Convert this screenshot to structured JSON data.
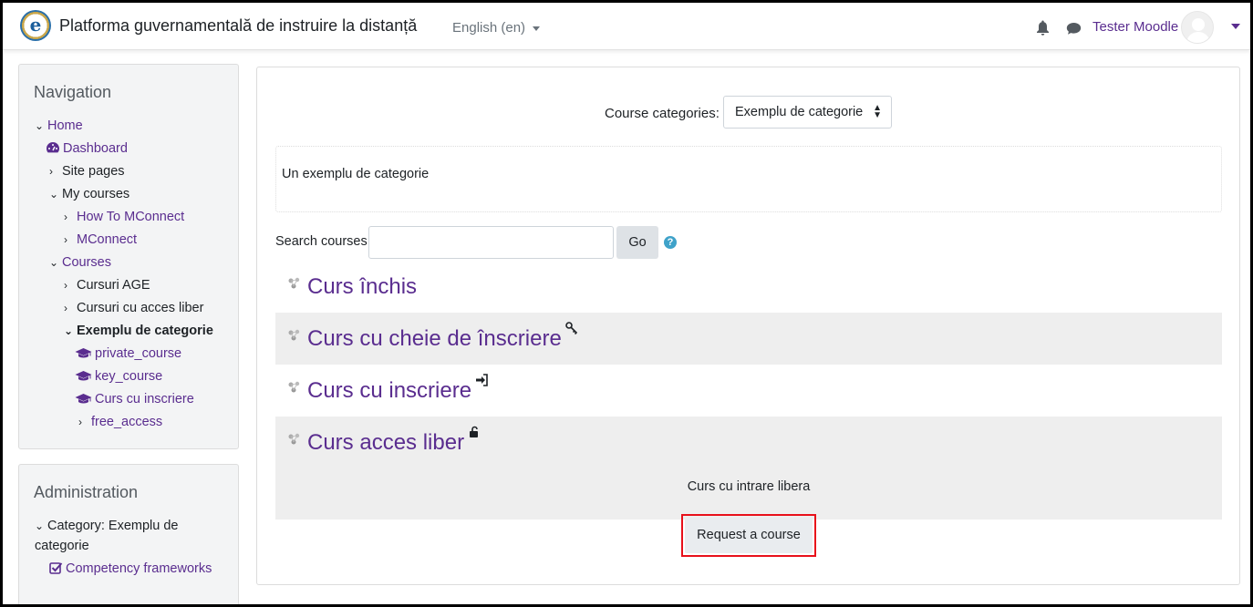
{
  "header": {
    "site_name": "Platforma guvernamentală de instruire la distanță",
    "language": "English (en)",
    "user_name": "Tester Moodle",
    "logo_letter": "e"
  },
  "navigation": {
    "title": "Navigation",
    "items": [
      {
        "label": "Home"
      },
      {
        "label": "Dashboard"
      },
      {
        "label": "Site pages"
      },
      {
        "label": "My courses"
      },
      {
        "label": "How To MConnect"
      },
      {
        "label": "MConnect"
      },
      {
        "label": "Courses"
      },
      {
        "label": "Cursuri AGE"
      },
      {
        "label": "Cursuri cu acces liber"
      },
      {
        "label": "Exemplu de categorie"
      },
      {
        "label": "private_course"
      },
      {
        "label": "key_course"
      },
      {
        "label": "Curs cu inscriere"
      },
      {
        "label": "free_access"
      }
    ]
  },
  "administration": {
    "title": "Administration",
    "category_line1": "Category: Exemplu de",
    "category_line2": "categorie",
    "competency": "Competency frameworks"
  },
  "main": {
    "categories_label": "Course categories:",
    "categories_selected": "Exemplu de categorie",
    "description": "Un exemplu de categorie",
    "search_label": "Search courses",
    "search_value": "",
    "go_label": "Go",
    "courses": [
      {
        "name": "Curs închis"
      },
      {
        "name": "Curs cu cheie de înscriere"
      },
      {
        "name": "Curs cu inscriere"
      },
      {
        "name": "Curs acces liber",
        "summary": "Curs cu intrare libera"
      }
    ],
    "request_button": "Request a course"
  },
  "colors": {
    "link": "#5a2d8f",
    "highlight_border": "#e8101a",
    "help": "#3fa2c9"
  }
}
